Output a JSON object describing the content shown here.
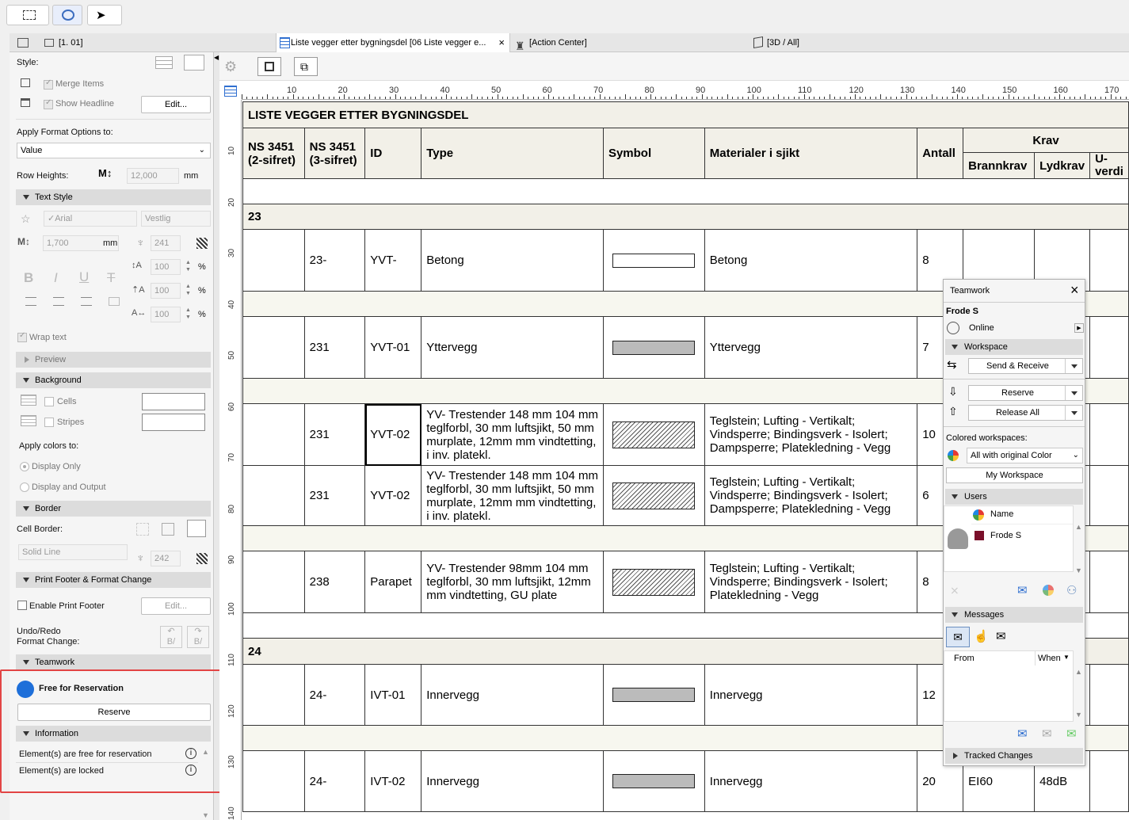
{
  "toolbar": {
    "arrow_tool": "▸"
  },
  "tabs": [
    {
      "label": "[1. 01]"
    },
    {
      "label": "Liste vegger etter bygningsdel [06 Liste vegger e...",
      "close": "×"
    },
    {
      "label": "[Action Center]"
    },
    {
      "label": "[3D / All]"
    }
  ],
  "left": {
    "style_label": "Style:",
    "merge_items": "Merge Items",
    "show_headline": "Show Headline",
    "edit_btn": "Edit...",
    "apply_format_label": "Apply Format Options to:",
    "apply_format_value": "Value",
    "row_heights_label": "Row Heights:",
    "row_heights_value": "12,000",
    "row_heights_unit": "mm",
    "text_style": "Text Style",
    "font": "Arial",
    "font_script": "Vestlig",
    "text_size": "1,700",
    "text_size_unit": "mm",
    "pen": "241",
    "pct1": "100",
    "pct2": "100",
    "pct3": "100",
    "pct_unit": "%",
    "wrap_text": "Wrap text",
    "preview": "Preview",
    "background": "Background",
    "cells": "Cells",
    "stripes": "Stripes",
    "apply_colors_label": "Apply colors to:",
    "display_only": "Display Only",
    "display_output": "Display and Output",
    "border": "Border",
    "cell_border": "Cell Border:",
    "line_type": "Solid Line",
    "border_pen": "242",
    "print_footer": "Print Footer & Format Change",
    "enable_footer": "Enable Print Footer",
    "edit_btn2": "Edit...",
    "undo_redo": "Undo/Redo",
    "format_change": "Format Change:",
    "teamwork": "Teamwork",
    "free_reservation": "Free for Reservation",
    "reserve": "Reserve",
    "information": "Information",
    "info1": "Element(s) are free for reservation",
    "info2": "Element(s) are locked"
  },
  "ruler": {
    "h_ticks": [
      "10",
      "20",
      "30",
      "40",
      "50",
      "60",
      "70",
      "80",
      "90",
      "100",
      "110",
      "120",
      "130",
      "140",
      "150",
      "160",
      "170"
    ],
    "v_ticks": [
      "10",
      "20",
      "30",
      "40",
      "50",
      "60",
      "70",
      "80",
      "90",
      "100",
      "110",
      "120",
      "130",
      "140"
    ]
  },
  "schedule": {
    "title": "LISTE VEGGER ETTER BYGNINGSDEL",
    "headers": {
      "ns2": "NS 3451 (2-sifret)",
      "ns3": "NS 3451 (3-sifret)",
      "id": "ID",
      "type": "Type",
      "symbol": "Symbol",
      "materials": "Materialer i sjikt",
      "antall": "Antall",
      "krav": "Krav",
      "brannkrav": "Brannkrav",
      "lydkrav": "Lydkrav",
      "uverdi": "U-verdi"
    },
    "group23": "23",
    "group24": "24",
    "rows": [
      {
        "ns3": "23-",
        "id": "YVT-",
        "type": "Betong",
        "sym": "line",
        "mat": "Betong",
        "antall": "8",
        "brann": "",
        "lyd": ""
      },
      {
        "ns3": "231",
        "id": "YVT-01",
        "type": "Yttervegg",
        "sym": "fill",
        "mat": "Yttervegg",
        "antall": "7",
        "brann": "",
        "lyd": ""
      },
      {
        "ns3": "231",
        "id": "YVT-02",
        "type": "YV- Trestender 148 mm 104 mm teglforbl, 30 mm luftsjikt, 50 mm murplate, 12mm mm vindtetting, i inv. platekl.",
        "sym": "hatch",
        "mat": "Teglstein; Lufting - Vertikalt; Vindsperre; Bindingsverk - Isolert; Dampsperre; Platekledning - Vegg",
        "antall": "10",
        "brann": "",
        "lyd": ""
      },
      {
        "ns3": "231",
        "id": "YVT-02",
        "type": "YV- Trestender 148 mm 104 mm teglforbl, 30 mm luftsjikt, 50 mm murplate, 12mm mm vindtetting, i inv. platekl.",
        "sym": "hatch",
        "mat": "Teglstein; Lufting - Vertikalt; Vindsperre; Bindingsverk - Isolert; Dampsperre; Platekledning - Vegg",
        "antall": "6",
        "brann": "",
        "lyd": ""
      },
      {
        "ns3": "238",
        "id": "Parapet",
        "type": "YV- Trestender 98mm 104 mm teglforbl, 30 mm luftsjikt, 12mm mm vindtetting, GU plate",
        "sym": "hatch",
        "mat": "Teglstein; Lufting - Vertikalt; Vindsperre; Bindingsverk - Isolert; Platekledning - Vegg",
        "antall": "8",
        "brann": "",
        "lyd": ""
      },
      {
        "ns3": "24-",
        "id": "IVT-01",
        "type": "Innervegg",
        "sym": "fill",
        "mat": "Innervegg",
        "antall": "12",
        "brann": "",
        "lyd": ""
      },
      {
        "ns3": "24-",
        "id": "IVT-02",
        "type": "Innervegg",
        "sym": "fill",
        "mat": "Innervegg",
        "antall": "20",
        "brann": "EI60",
        "lyd": "48dB"
      }
    ]
  },
  "teamwork": {
    "title": "Teamwork",
    "user": "Frode S",
    "status": "Online",
    "workspace": "Workspace",
    "send_receive": "Send & Receive",
    "reserve": "Reserve",
    "release_all": "Release All",
    "colored_label": "Colored workspaces:",
    "colored_value": "All with original Color",
    "my_workspace": "My Workspace",
    "users": "Users",
    "name_col": "Name",
    "user1": "Frode S",
    "messages": "Messages",
    "from_col": "From",
    "when_col": "When",
    "tracked": "Tracked Changes"
  },
  "colors": {
    "accent_blue": "#1e6fd9",
    "highlight_red": "#e24444",
    "user_color": "#7a0f2a"
  }
}
